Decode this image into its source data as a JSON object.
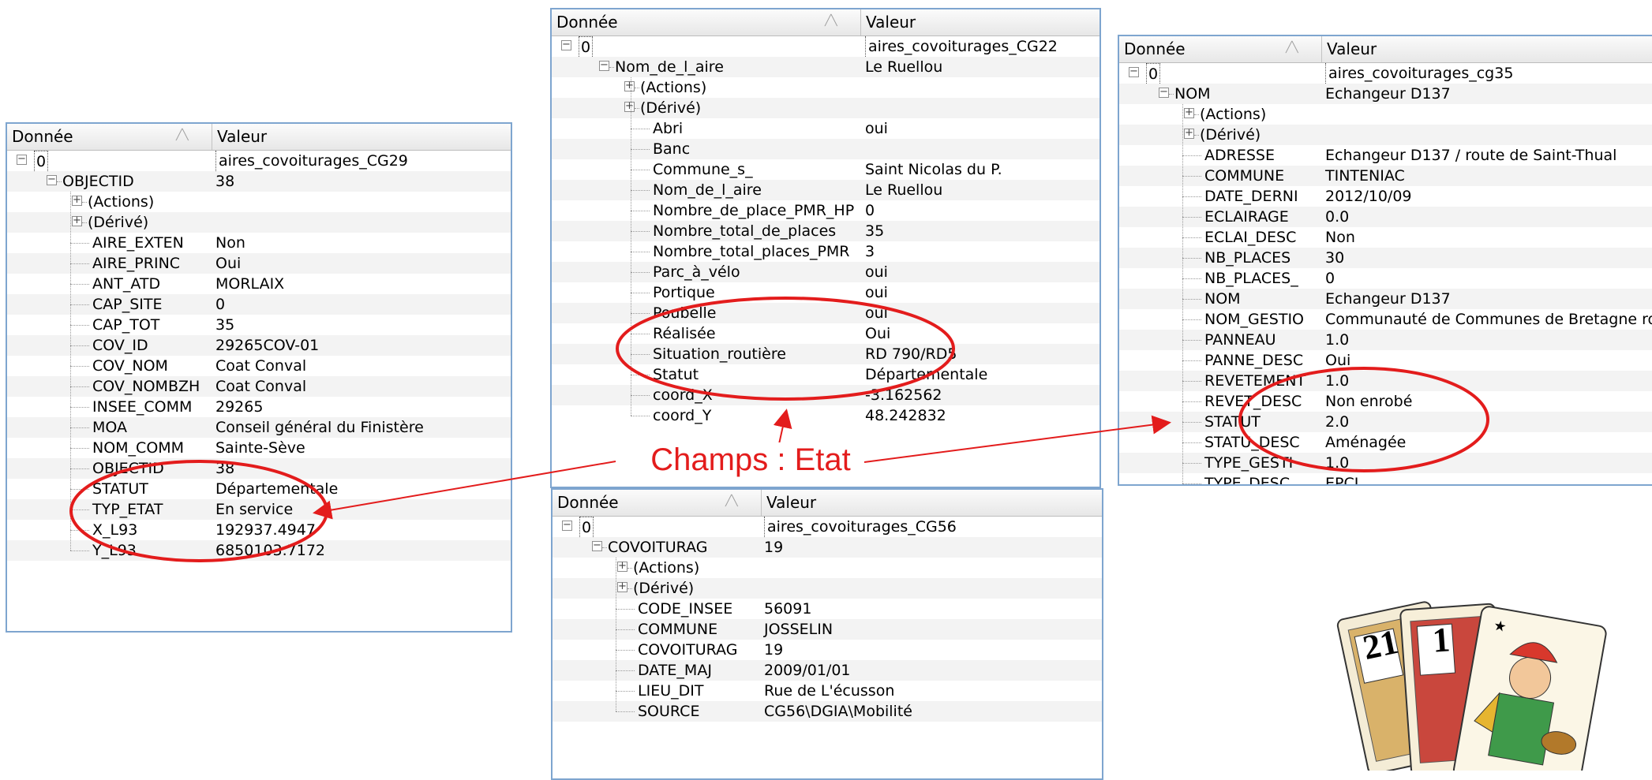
{
  "header": {
    "col_data": "Donnée",
    "col_value": "Valeur"
  },
  "panel_cg29": {
    "root_key": "0",
    "root_value": "aires_covoiturages_CG29",
    "group_key": "OBJECTID",
    "group_value": "38",
    "actions": "(Actions)",
    "derived": "(Dérivé)",
    "fields": [
      {
        "k": "AIRE_EXTEN",
        "v": "Non"
      },
      {
        "k": "AIRE_PRINC",
        "v": "Oui"
      },
      {
        "k": "ANT_ATD",
        "v": "MORLAIX"
      },
      {
        "k": "CAP_SITE",
        "v": "0"
      },
      {
        "k": "CAP_TOT",
        "v": "35"
      },
      {
        "k": "COV_ID",
        "v": "29265COV-01"
      },
      {
        "k": "COV_NOM",
        "v": "Coat Conval"
      },
      {
        "k": "COV_NOMBZH",
        "v": "Coat Conval"
      },
      {
        "k": "INSEE_COMM",
        "v": "29265"
      },
      {
        "k": "MOA",
        "v": "Conseil général du Finistère"
      },
      {
        "k": "NOM_COMM",
        "v": "Sainte-Sève"
      },
      {
        "k": "OBJECTID",
        "v": "38"
      },
      {
        "k": "STATUT",
        "v": "Départementale"
      },
      {
        "k": "TYP_ETAT",
        "v": "En service"
      },
      {
        "k": "X_L93",
        "v": "192937.4947"
      },
      {
        "k": "Y_L93",
        "v": "6850103.7172"
      }
    ]
  },
  "panel_cg22": {
    "root_key": "0",
    "root_value": "aires_covoiturages_CG22",
    "group_key": "Nom_de_l_aire",
    "group_value": "Le Ruellou",
    "actions": "(Actions)",
    "derived": "(Dérivé)",
    "fields": [
      {
        "k": "Abri",
        "v": "oui"
      },
      {
        "k": "Banc",
        "v": ""
      },
      {
        "k": "Commune_s_",
        "v": "Saint Nicolas du P."
      },
      {
        "k": "Nom_de_l_aire",
        "v": "Le Ruellou"
      },
      {
        "k": "Nombre_de_place_PMR_HP",
        "v": "0"
      },
      {
        "k": "Nombre_total_de_places",
        "v": "35"
      },
      {
        "k": "Nombre_total_places_PMR",
        "v": "3"
      },
      {
        "k": "Parc_à_vélo",
        "v": "oui"
      },
      {
        "k": "Portique",
        "v": "oui"
      },
      {
        "k": "Poubelle",
        "v": "oui"
      },
      {
        "k": "Réalisée",
        "v": "Oui"
      },
      {
        "k": "Situation_routière",
        "v": "RD 790/RD5"
      },
      {
        "k": "Statut",
        "v": "Départementale"
      },
      {
        "k": "coord_X",
        "v": "-3.162562"
      },
      {
        "k": "coord_Y",
        "v": "48.242832"
      }
    ]
  },
  "panel_cg35": {
    "root_key": "0",
    "root_value": "aires_covoiturages_cg35",
    "group_key": "NOM",
    "group_value": "Echangeur D137",
    "actions": "(Actions)",
    "derived": "(Dérivé)",
    "fields": [
      {
        "k": "ADRESSE",
        "v": "Echangeur D137 / route de Saint-Thual"
      },
      {
        "k": "COMMUNE",
        "v": "TINTENIAC"
      },
      {
        "k": "DATE_DERNI",
        "v": "2012/10/09"
      },
      {
        "k": "ECLAIRAGE",
        "v": "0.0"
      },
      {
        "k": "ECLAI_DESC",
        "v": "Non"
      },
      {
        "k": "NB_PLACES",
        "v": "30"
      },
      {
        "k": "NB_PLACES_",
        "v": "0"
      },
      {
        "k": "NOM",
        "v": "Echangeur D137"
      },
      {
        "k": "NOM_GESTIO",
        "v": "Communauté de Communes de Bretagne ro"
      },
      {
        "k": "PANNEAU",
        "v": "1.0"
      },
      {
        "k": "PANNE_DESC",
        "v": "Oui"
      },
      {
        "k": "REVETEMENT",
        "v": "1.0"
      },
      {
        "k": "REVET_DESC",
        "v": "Non enrobé"
      },
      {
        "k": "STATUT",
        "v": "2.0"
      },
      {
        "k": "STATU_DESC",
        "v": "Aménagée"
      },
      {
        "k": "TYPE_GESTI",
        "v": "1.0"
      },
      {
        "k": "TYPE_DESC",
        "v": "EPCI"
      }
    ]
  },
  "panel_cg56": {
    "root_key": "0",
    "root_value": "aires_covoiturages_CG56",
    "group_key": "COVOITURAG",
    "group_value": "19",
    "actions": "(Actions)",
    "derived": "(Dérivé)",
    "fields": [
      {
        "k": "CODE_INSEE",
        "v": "56091"
      },
      {
        "k": "COMMUNE",
        "v": "JOSSELIN"
      },
      {
        "k": "COVOITURAG",
        "v": "19"
      },
      {
        "k": "DATE_MAJ",
        "v": "2009/01/01"
      },
      {
        "k": "LIEU_DIT",
        "v": "Rue de L'écusson"
      },
      {
        "k": "SOURCE",
        "v": "CG56\\DGIA\\Mobilité"
      }
    ]
  },
  "annotation": {
    "text": "Champs : Etat",
    "color": "#e31c1c"
  },
  "card_numbers": {
    "left": "21",
    "right": "1"
  }
}
